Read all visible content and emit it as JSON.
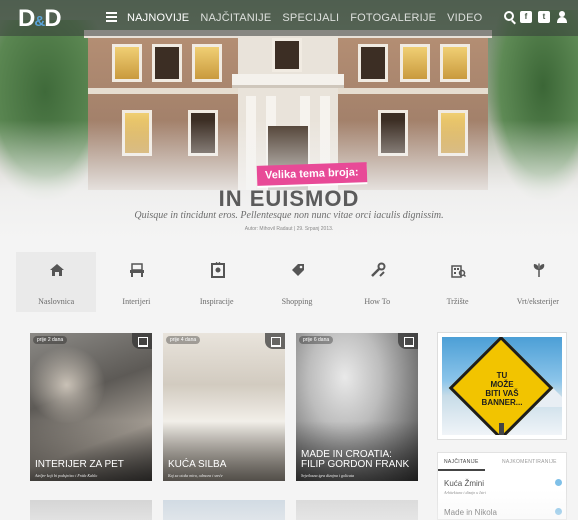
{
  "brand": {
    "logo_left": "D",
    "logo_amp": "&",
    "logo_right": "D"
  },
  "nav": {
    "items": [
      {
        "label": "NAJNOVIJE",
        "active": true
      },
      {
        "label": "NAJČITANIJE",
        "active": false
      },
      {
        "label": "SPECIJALI",
        "active": false
      },
      {
        "label": "FOTOGALERIJE",
        "active": false
      },
      {
        "label": "VIDEO",
        "active": false
      }
    ],
    "icons": [
      "search-icon",
      "facebook-icon",
      "twitter-icon",
      "user-icon"
    ],
    "facebook_glyph": "f",
    "twitter_glyph": "t"
  },
  "hero": {
    "tag": "Velika tema broja:",
    "title": "IN EUISMOD",
    "subtitle": "Quisque in tincidunt eros. Pellentesque non nunc vitae orci iaculis dignissim.",
    "byline": "Autor: Mihovil Radaut | 29. Srpanj 2013."
  },
  "categories": [
    {
      "label": "Naslovnica",
      "icon": "home-icon",
      "active": true
    },
    {
      "label": "Interijeri",
      "icon": "furniture-icon",
      "active": false
    },
    {
      "label": "Inspiracije",
      "icon": "frame-icon",
      "active": false
    },
    {
      "label": "Shopping",
      "icon": "tag-icon",
      "active": false
    },
    {
      "label": "How To",
      "icon": "tools-icon",
      "active": false
    },
    {
      "label": "Tržište",
      "icon": "building-icon",
      "active": false
    },
    {
      "label": "Vrt/eksterijer",
      "icon": "plant-icon",
      "active": false
    }
  ],
  "cards": [
    {
      "pill": "prije 2 dana",
      "title": "INTERIJER ZA PET",
      "subtitle": "Ateljer koji bi podsjećao i Frida Kahlo"
    },
    {
      "pill": "prije 4 dana",
      "title": "KUĆA SILBA",
      "subtitle": "Kaj sa otoka mira, odmora i sreće"
    },
    {
      "pill": "prije 6 dana",
      "title": "MADE IN CROATIA: FILIP GORDON FRANK",
      "subtitle": "Svjetlosna igra dizajna i golicata"
    }
  ],
  "banner": {
    "line1": "TU",
    "line2": "MOŽE",
    "line3": "BITI VAŠ",
    "line4": "BANNER..."
  },
  "sidebar_tabs": {
    "tab1": "NAJČITANIJE",
    "tab2": "NAJKOMENTIRANIJE",
    "items": [
      {
        "title": "Kuća Žmini",
        "subtitle": "Arhitektura i dizajn u Istri"
      },
      {
        "title": "Made in Nikola",
        "subtitle": ""
      }
    ]
  },
  "colors": {
    "accent_pink": "#e84a97",
    "accent_blue": "#5aa3d8",
    "nav_bg": "#373c3a"
  }
}
